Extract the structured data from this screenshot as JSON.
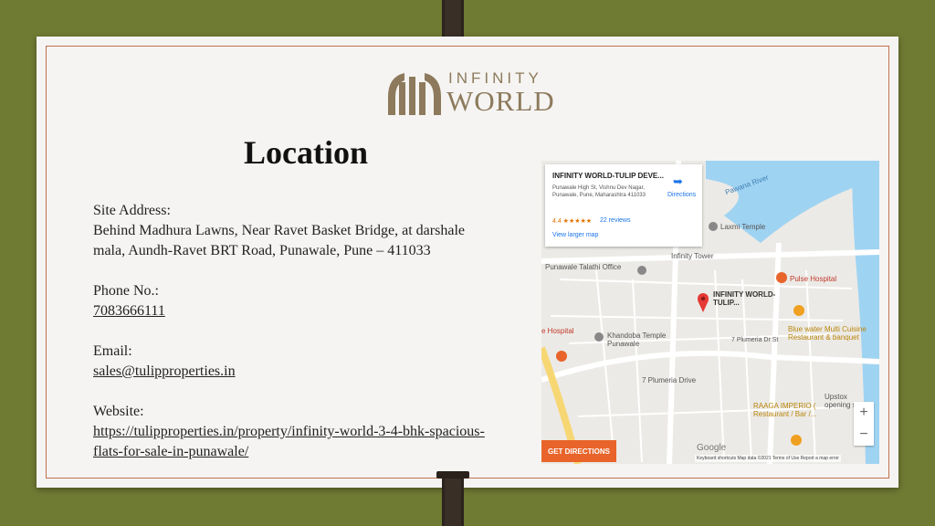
{
  "logo": {
    "line1": "INFINITY",
    "line2": "WORLD",
    "brand_color": "#8d7a5c"
  },
  "title": "Location",
  "site": {
    "label": "Site Address:",
    "value": "Behind Madhura Lawns, Near Ravet Basket Bridge, at darshale mala, Aundh-Ravet BRT Road, Punawale, Pune – 411033"
  },
  "phone": {
    "label": "Phone No.:",
    "value": "7083666111"
  },
  "email": {
    "label": "Email:",
    "value": "sales@tulipproperties.in"
  },
  "website": {
    "label": "Website:",
    "value": "https://tulipproperties.in/property/infinity-world-3-4-bhk-spacious-flats-for-sale-in-punawale/"
  },
  "map": {
    "card_title": "INFINITY WORLD-TULIP DEVE...",
    "card_address": "Punawale High St, Vishnu Dev Nagar, Punawale, Pune, Maharashtra 411033",
    "rating": "4.4 ★★★★★",
    "reviews": "22 reviews",
    "view_larger": "View larger map",
    "directions": "Directions",
    "pawana_river": "Pawana River",
    "laxmi_temple": "Laxmi Temple",
    "infinity_tower": "Infinity Tower",
    "talathi": "Punawale Talathi Office",
    "pulse": "Pulse Hospital",
    "pin_label": "INFINITY WORLD-TULIP...",
    "blue_water": "Blue water Multi Cuisine Restaurant & banquet",
    "hospital": "e Hospital",
    "khandoba": "Khandoba Temple Punawale",
    "plumeria_dr": "7 Plumeria Dr St",
    "plumeria_drive": "7 Plumeria Drive",
    "raaga": "RAAGA IMPERIO ( Restaurant / Bar /...",
    "upstox": "Upstox opening su...",
    "get_directions": "GET DIRECTIONS",
    "google": "Google",
    "footer": "Keyboard shortcuts   Map data ©2021   Terms of Use   Report a map error",
    "zoom_in": "+",
    "zoom_out": "−",
    "accent_red": "#e53935",
    "river_color": "#9fd3f2"
  }
}
